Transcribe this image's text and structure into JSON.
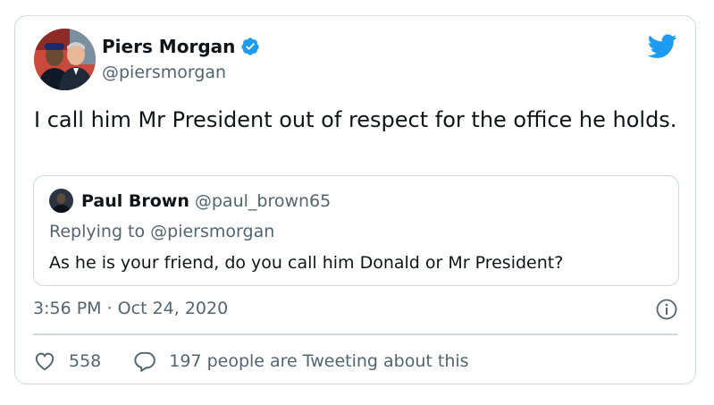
{
  "tweet": {
    "author": {
      "name": "Piers Morgan",
      "handle": "@piersmorgan"
    },
    "text": "I call him Mr President out of respect for the office he holds.",
    "timestamp": "3:56 PM · Oct 24, 2020",
    "likes": "558",
    "retweet_text": "197 people are Tweeting about this"
  },
  "quoted": {
    "name": "Paul Brown",
    "handle": "@paul_brown65",
    "replying_to": "Replying to @piersmorgan",
    "text": "As he is your friend, do you call him Donald or Mr President?"
  },
  "colors": {
    "twitter_blue": "#1d9bf0",
    "muted": "#536471",
    "border": "#cfd9de"
  },
  "icons": [
    "verified-badge-icon",
    "twitter-bird-icon",
    "info-icon",
    "heart-icon",
    "comment-icon"
  ]
}
